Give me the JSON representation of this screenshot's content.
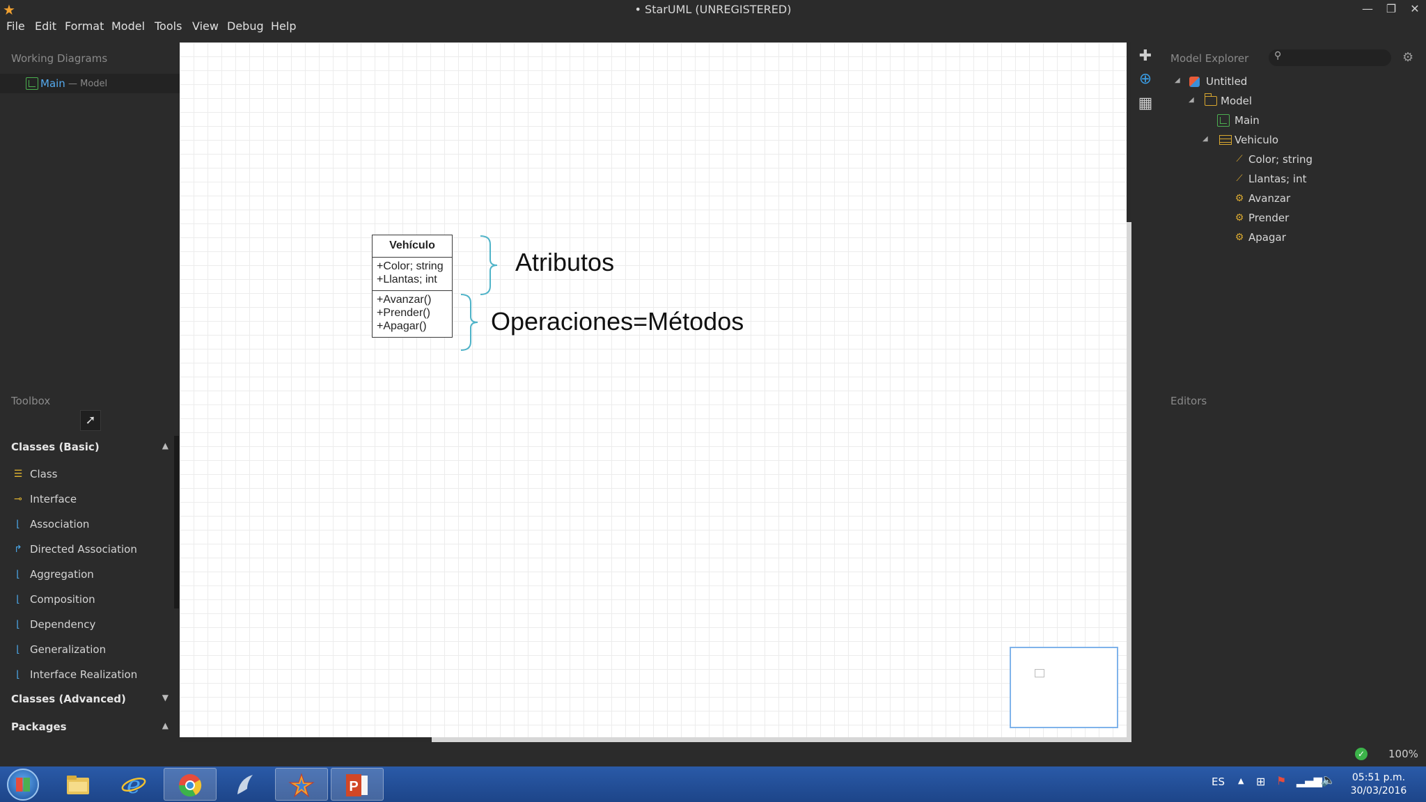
{
  "window": {
    "title": "• StarUML (UNREGISTERED)",
    "minimize": "—",
    "restore": "❐",
    "close": "✕"
  },
  "menu": [
    "File",
    "Edit",
    "Format",
    "Model",
    "Tools",
    "View",
    "Debug",
    "Help"
  ],
  "working_diagrams": {
    "header": "Working Diagrams",
    "item_name": "Main",
    "item_sub": "— Model"
  },
  "toolbox": {
    "header": "Toolbox",
    "categories": [
      {
        "label": "Classes (Basic)",
        "arrow": "▲"
      },
      {
        "label": "Classes (Advanced)",
        "arrow": "▼"
      },
      {
        "label": "Packages",
        "arrow": "▲"
      }
    ],
    "items": [
      "Class",
      "Interface",
      "Association",
      "Directed Association",
      "Aggregation",
      "Composition",
      "Dependency",
      "Generalization",
      "Interface Realization"
    ]
  },
  "diagram": {
    "class_name": "Vehículo",
    "attributes": [
      "+Color; string",
      "+Llantas; int"
    ],
    "operations": [
      "+Avanzar()",
      "+Prender()",
      "+Apagar()"
    ],
    "note_attrs": "Atributos",
    "note_ops": "Operaciones=Métodos"
  },
  "model_explorer": {
    "header": "Model Explorer",
    "tree": [
      "Untitled",
      "Model",
      "Main",
      "Vehiculo",
      "Color; string",
      "Llantas; int",
      "Avanzar",
      "Prender",
      "Apagar"
    ]
  },
  "editors": {
    "header": "Editors"
  },
  "status": {
    "zoom": "100%"
  },
  "taskbar": {
    "lang": "ES",
    "time": "05:51 p.m.",
    "date": "30/03/2016"
  }
}
